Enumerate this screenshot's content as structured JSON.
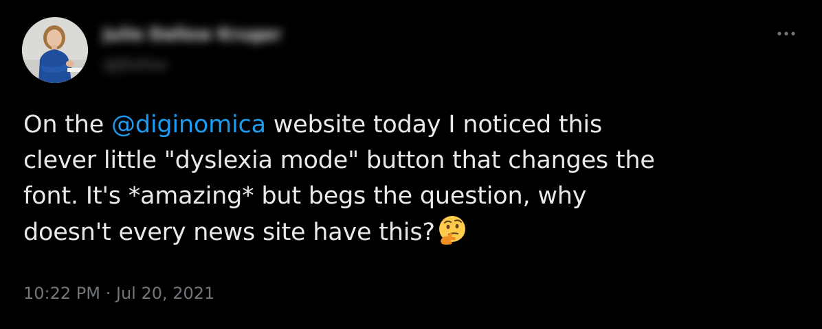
{
  "tweet": {
    "author": {
      "name": "Julie Dallow Kruger",
      "handle": "@JDallow"
    },
    "more_icon": "more-horizontal-icon",
    "text": {
      "line1_prefix": "On the ",
      "mention": "@diginomica",
      "line1_suffix": " website today I noticed this",
      "line2": "clever little \"dyslexia mode\" button that changes the",
      "line3": "font. It's *amazing* but begs the question, why",
      "line4": "doesn't every news site have this?"
    },
    "emoji": "thinking-face-icon",
    "timestamp": "10:22 PM · Jul 20, 2021"
  },
  "colors": {
    "background": "#000000",
    "text": "#e7e9ea",
    "mention": "#1d9bf0",
    "secondary": "#71767b"
  }
}
